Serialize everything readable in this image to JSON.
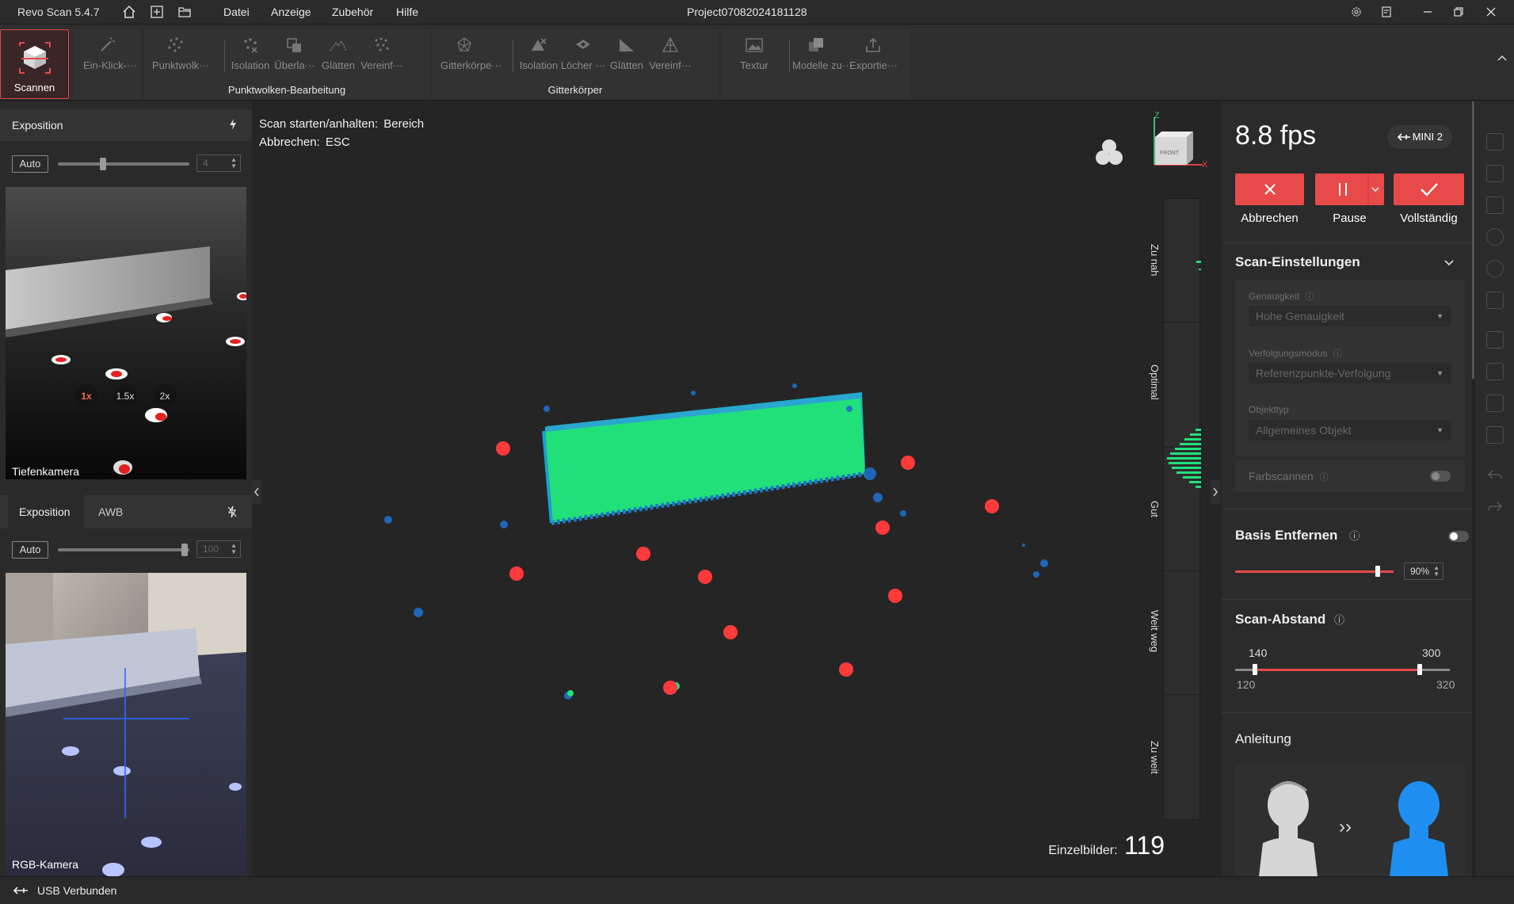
{
  "titlebar": {
    "app_title": "Revo Scan 5.4.7",
    "menus": [
      "Datei",
      "Anzeige",
      "Zubehör",
      "Hilfe"
    ],
    "project": "Project07082024181128"
  },
  "ribbon": {
    "scan_label": "Scannen",
    "tool_oneclick": "Ein-Klick-···",
    "pc_tools": [
      "Punktwolk···",
      "Isolation",
      "Überla···",
      "Glätten",
      "Vereinf···"
    ],
    "pc_group": "Punktwolken-Bearbeitung",
    "mesh_tools": [
      "Gitterkörpe···",
      "Isolation",
      "Löcher ···",
      "Glätten",
      "Vereinf···"
    ],
    "mesh_group": "Gitterkörper",
    "extra_tools": [
      "Textur",
      "Modelle zu···",
      "Exportie···"
    ]
  },
  "left": {
    "depth_header": "Exposition",
    "depth_auto": "Auto",
    "depth_value": "4",
    "depth_label": "Tiefenkamera",
    "zoom": [
      "1x",
      "1.5x",
      "2x"
    ],
    "rgb_tab1": "Exposition",
    "rgb_tab2": "AWB",
    "rgb_auto": "Auto",
    "rgb_value": "100",
    "rgb_label": "RGB-Kamera"
  },
  "viewport": {
    "hint1_key": "Scan starten/anhalten:",
    "hint1_val": "Bereich",
    "hint2_key": "Abbrechen:",
    "hint2_val": "ESC",
    "axis_z": "Z",
    "axis_x": "X",
    "cube_face": "FRONT",
    "distance_labels": [
      "Zu nah",
      "Optimal",
      "Gut",
      "Weit weg",
      "Zu weit"
    ],
    "frames_label": "Einzelbilder:",
    "frames_value": "119"
  },
  "right": {
    "fps": "8.8 fps",
    "device": "MINI 2",
    "cancel_label": "Abbrechen",
    "pause_label": "Pause",
    "complete_label": "Vollständig",
    "scan_settings_title": "Scan-Einstellungen",
    "accuracy_label": "Genauigkeit",
    "accuracy_value": "Hohe Genauigkeit",
    "tracking_label": "Verfolgungsmodus",
    "tracking_value": "Referenzpunkte-Verfolgung",
    "object_label": "Objekttyp",
    "object_value": "Allgemeines Objekt",
    "color_scan_label": "Farbscannen",
    "remove_base_title": "Basis Entfernen",
    "remove_base_value": "90%",
    "remove_base_level": 0.9,
    "distance_title": "Scan-Abstand",
    "distance_low": "140",
    "distance_high": "300",
    "distance_min": "120",
    "distance_max": "320",
    "guide_title": "Anleitung"
  },
  "status": {
    "text": "USB Verbunden"
  },
  "colors": {
    "accent_red": "#e84a4a",
    "scan_green": "#1ee07a",
    "marker_red": "#ff3b3b"
  }
}
